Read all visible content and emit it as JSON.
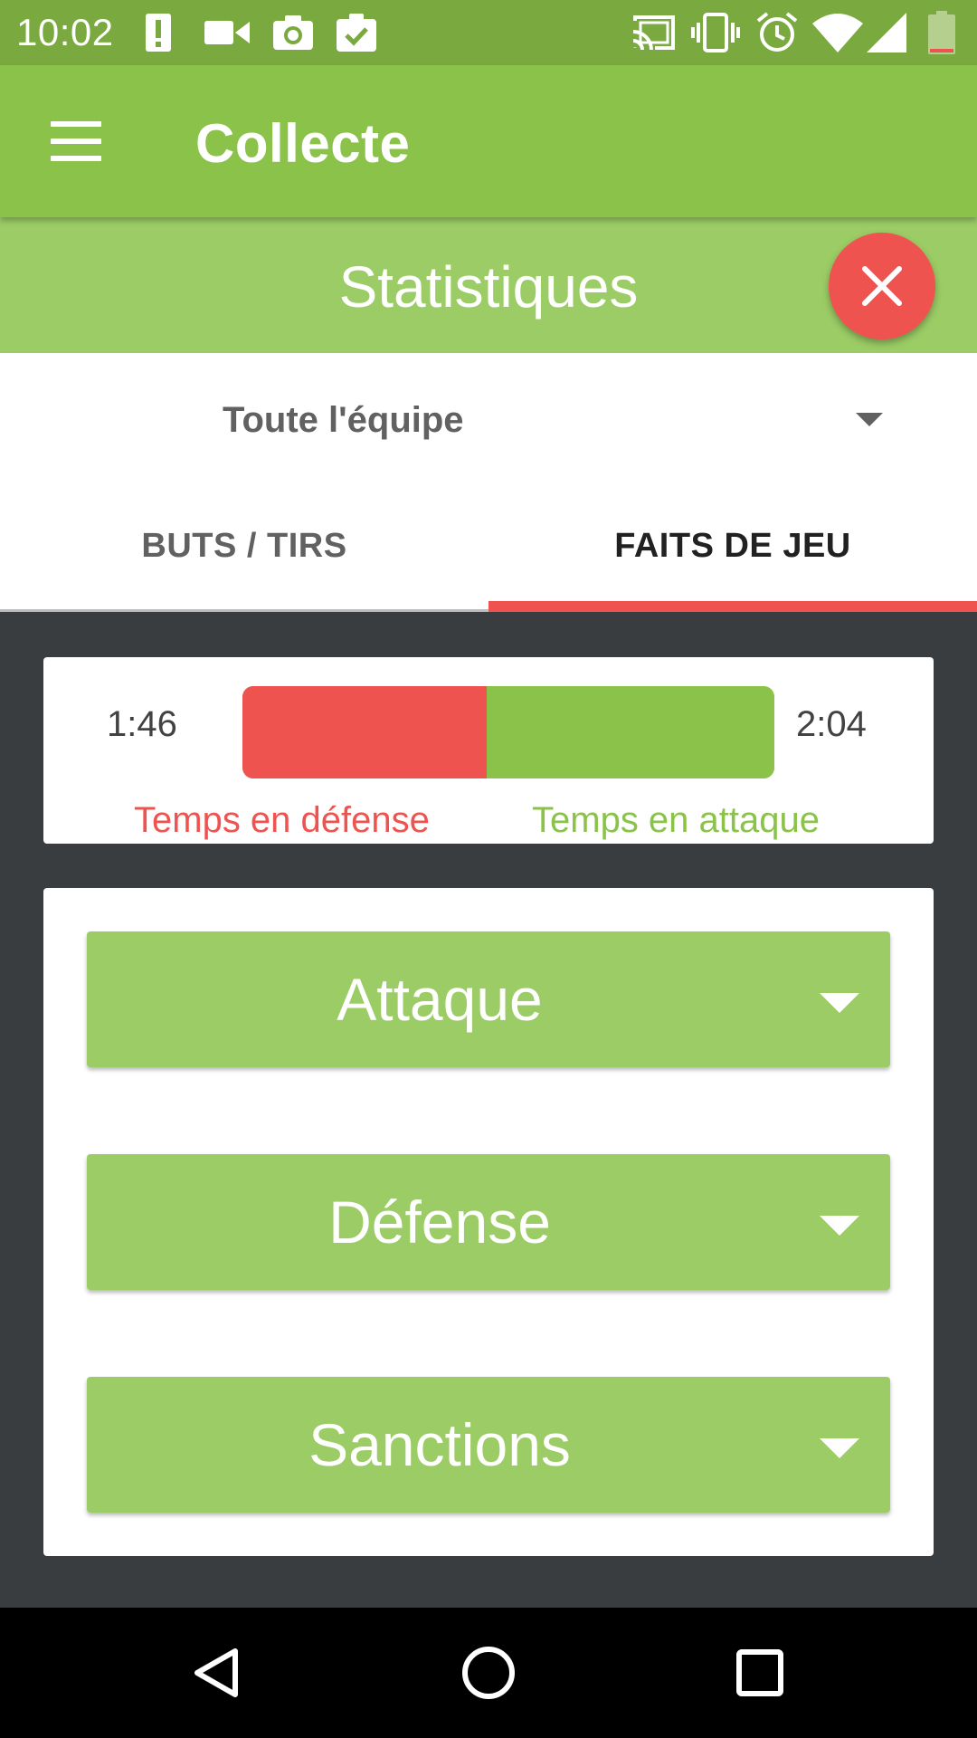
{
  "status_bar": {
    "time": "10:02",
    "left_icons": [
      "alert-icon",
      "video-icon",
      "camera-icon",
      "clipboard-check-icon"
    ],
    "right_icons": [
      "cast-icon",
      "vibrate-icon",
      "alarm-icon",
      "wifi-icon",
      "signal-icon",
      "battery-icon"
    ]
  },
  "app_bar": {
    "title": "Collecte",
    "menu_icon": "menu-icon"
  },
  "stats_header": {
    "title": "Statistiques",
    "close_icon": "close-icon"
  },
  "team_selector": {
    "value": "Toute l'équipe"
  },
  "tabs": [
    {
      "label": "BUTS / TIRS",
      "selected": false
    },
    {
      "label": "FAITS DE JEU",
      "selected": true
    }
  ],
  "time_stats": {
    "defense_time": "1:46",
    "attack_time": "2:04",
    "defense_label": "Temps en défense",
    "attack_label": "Temps en attaque",
    "defense_share": 0.46
  },
  "categories": [
    {
      "label": "Attaque"
    },
    {
      "label": "Défense"
    },
    {
      "label": "Sanctions"
    }
  ],
  "colors": {
    "status_bar": "#79a93f",
    "primary": "#8bc34a",
    "primary_light": "#9ccc65",
    "accent": "#ef5350",
    "content_bg": "#3a3d40"
  }
}
